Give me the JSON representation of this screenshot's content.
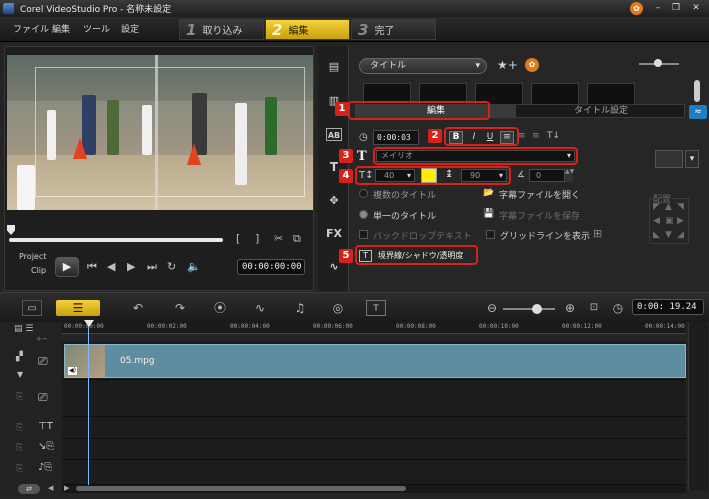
{
  "window": {
    "title": "Corel VideoStudio Pro - 名称未設定"
  },
  "menu": [
    "ファイル",
    "編集",
    "ツール",
    "設定"
  ],
  "steps": [
    {
      "num": "1",
      "label": "取り込み"
    },
    {
      "num": "2",
      "label": "編集"
    },
    {
      "num": "3",
      "label": "完了"
    }
  ],
  "preview": {
    "project_label": "Project",
    "clip_label": "Clip",
    "timecode": "00:00:00:00"
  },
  "library": {
    "dropdown": "タイトル"
  },
  "options": {
    "tab_edit": "編集",
    "tab_title_settings": "タイトル設定",
    "duration": "0:00:03",
    "font": "メイリオ",
    "font_size": "40",
    "line_spacing": "90",
    "angle": "0",
    "multi_title": "複数のタイトル",
    "single_title": "単一のタイトル",
    "back_text": "バックドロップテキスト",
    "open_subtitle": "字幕ファイルを開く",
    "save_subtitle": "字幕ファイルを保存",
    "show_grid": "グリッドラインを表示",
    "border_shadow": "境界線/シャドウ/透明度",
    "align_label": "配置",
    "font_color": "#ffee00"
  },
  "callouts": [
    "1",
    "2",
    "3",
    "4",
    "5"
  ],
  "timeline": {
    "timecode": "0:00: 19.24",
    "ruler": [
      "00:00:00:00",
      "00:00:02:00",
      "00:00:04:00",
      "00:00:06:00",
      "00:00:08:00",
      "00:00:10:00",
      "00:00:12:00",
      "00:00:14:00"
    ],
    "clip_name": "05.mpg"
  },
  "colors": {
    "accent": "#e8c21f",
    "callout": "#d8211a",
    "clip": "#5f8da0"
  }
}
